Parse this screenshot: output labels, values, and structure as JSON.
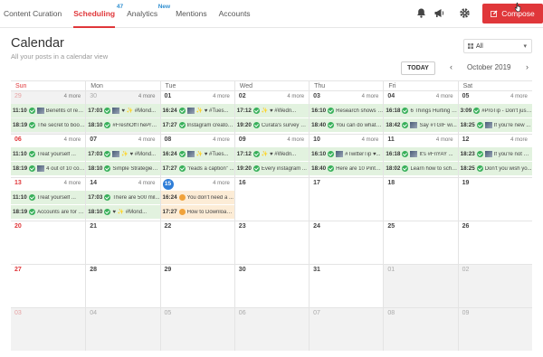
{
  "nav": {
    "items": [
      {
        "label": "Content Curation",
        "badge": "",
        "active": false
      },
      {
        "label": "Scheduling",
        "badge": "47",
        "active": true
      },
      {
        "label": "Analytics",
        "badge": "New",
        "active": false
      },
      {
        "label": "Mentions",
        "badge": "",
        "active": false
      },
      {
        "label": "Accounts",
        "badge": "",
        "active": false
      }
    ],
    "compose_label": "Compose"
  },
  "header": {
    "title": "Calendar",
    "subtitle": "All your posts in a calendar view",
    "filter_value": "All",
    "today_label": "TODAY",
    "month_label": "October 2019"
  },
  "calendar": {
    "day_names": [
      "Sun",
      "Mon",
      "Tue",
      "Wed",
      "Thu",
      "Fri",
      "Sat"
    ],
    "weeks": [
      [
        {
          "day": "29",
          "muted": true,
          "more": "4 more",
          "posts": [
            {
              "time": "11:10",
              "status": "ok",
              "thumb": true,
              "text": "Benefits of red..."
            },
            {
              "time": "18:19",
              "status": "ok",
              "thumb": false,
              "text": "The secret to boos..."
            }
          ]
        },
        {
          "day": "30",
          "muted": true,
          "more": "4 more",
          "posts": [
            {
              "time": "17:03",
              "status": "ok",
              "thumb": true,
              "text": "♥ ✨ #Mond..."
            },
            {
              "time": "18:10",
              "status": "ok",
              "thumb": false,
              "text": "#FreshOffThePres..."
            }
          ]
        },
        {
          "day": "01",
          "muted": false,
          "more": "4 more",
          "posts": [
            {
              "time": "16:24",
              "status": "ok",
              "thumb": true,
              "text": "✨ ♥ #Tues..."
            },
            {
              "time": "17:27",
              "status": "ok",
              "thumb": false,
              "text": "Instagram creator ..."
            }
          ]
        },
        {
          "day": "02",
          "muted": false,
          "more": "4 more",
          "posts": [
            {
              "time": "17:12",
              "status": "ok",
              "thumb": false,
              "text": "✨ ♥ #Wedn..."
            },
            {
              "time": "19:20",
              "status": "ok",
              "thumb": false,
              "text": "Curata's survey sa..."
            }
          ]
        },
        {
          "day": "03",
          "muted": false,
          "more": "4 more",
          "posts": [
            {
              "time": "16:10",
              "status": "ok",
              "thumb": false,
              "text": "Research shows th..."
            },
            {
              "time": "18:40",
              "status": "ok",
              "thumb": false,
              "text": "You can do whate..."
            }
          ]
        },
        {
          "day": "04",
          "muted": false,
          "more": "4 more",
          "posts": [
            {
              "time": "16:18",
              "status": "ok",
              "thumb": false,
              "text": "6 Things Hurting y..."
            },
            {
              "time": "18:42",
              "status": "ok",
              "thumb": true,
              "text": "Say #TGIF wi..."
            }
          ]
        },
        {
          "day": "05",
          "muted": false,
          "more": "4 more",
          "posts": [
            {
              "time": "3:09",
              "status": "ok",
              "thumb": false,
              "text": "#ProTip - Don't just..."
            },
            {
              "time": "18:25",
              "status": "ok",
              "thumb": true,
              "text": "If you're new ..."
            }
          ]
        }
      ],
      [
        {
          "day": "06",
          "muted": false,
          "more": "4 more",
          "posts": [
            {
              "time": "11:10",
              "status": "ok",
              "thumb": false,
              "text": "Treat yourself ..."
            },
            {
              "time": "18:19",
              "status": "ok",
              "thumb": true,
              "text": "4 out of 10 consum..."
            }
          ]
        },
        {
          "day": "07",
          "muted": false,
          "more": "4 more",
          "posts": [
            {
              "time": "17:03",
              "status": "ok",
              "thumb": true,
              "text": "✨ ♥ #Mond..."
            },
            {
              "time": "18:10",
              "status": "ok",
              "thumb": false,
              "text": "Simple Strategies t..."
            }
          ]
        },
        {
          "day": "08",
          "muted": false,
          "more": "4 more",
          "posts": [
            {
              "time": "16:24",
              "status": "ok",
              "thumb": true,
              "text": "✨ ♥ #Tues..."
            },
            {
              "time": "17:27",
              "status": "ok",
              "thumb": false,
              "text": "\"reads a caption\" ..."
            }
          ]
        },
        {
          "day": "09",
          "muted": false,
          "more": "4 more",
          "posts": [
            {
              "time": "17:12",
              "status": "ok",
              "thumb": false,
              "text": "✨ ♥ #Wedn..."
            },
            {
              "time": "19:20",
              "status": "ok",
              "thumb": false,
              "text": "Every instagram ..."
            }
          ]
        },
        {
          "day": "10",
          "muted": false,
          "more": "4 more",
          "posts": [
            {
              "time": "16:10",
              "status": "ok",
              "thumb": true,
              "text": "#TwitterTip ♥..."
            },
            {
              "time": "18:40",
              "status": "ok",
              "thumb": false,
              "text": "Here are 10 Pinter..."
            }
          ]
        },
        {
          "day": "11",
          "muted": false,
          "more": "4 more",
          "posts": [
            {
              "time": "16:18",
              "status": "ok",
              "thumb": true,
              "text": "It's #FriYAY ..."
            },
            {
              "time": "18:02",
              "status": "ok",
              "thumb": false,
              "text": "Learn how to sche..."
            }
          ]
        },
        {
          "day": "12",
          "muted": false,
          "more": "4 more",
          "posts": [
            {
              "time": "18:23",
              "status": "ok",
              "thumb": true,
              "text": "If you're not a ..."
            },
            {
              "time": "18:25",
              "status": "ok",
              "thumb": false,
              "text": "Don't you wish yo..."
            }
          ]
        }
      ],
      [
        {
          "day": "13",
          "muted": false,
          "more": "4 more",
          "posts": [
            {
              "time": "11:10",
              "status": "ok",
              "thumb": false,
              "text": "Treat yourself ..."
            },
            {
              "time": "18:19",
              "status": "ok",
              "thumb": false,
              "text": "Accounts are for s..."
            }
          ]
        },
        {
          "day": "14",
          "muted": false,
          "more": "4 more",
          "posts": [
            {
              "time": "17:03",
              "status": "ok",
              "thumb": false,
              "text": "There are 500 mil..."
            },
            {
              "time": "18:10",
              "status": "ok",
              "thumb": false,
              "text": "♥ ✨ #Mond..."
            }
          ]
        },
        {
          "day": "15",
          "muted": false,
          "today": true,
          "more": "4 more",
          "posts": [
            {
              "time": "16:24",
              "status": "wait",
              "thumb": false,
              "text": "You don't need a ..."
            },
            {
              "time": "17:27",
              "status": "wait",
              "thumb": false,
              "text": "How to Download ..."
            }
          ]
        },
        {
          "day": "16",
          "muted": false,
          "more": "",
          "posts": []
        },
        {
          "day": "17",
          "muted": false,
          "more": "",
          "posts": []
        },
        {
          "day": "18",
          "muted": false,
          "more": "",
          "posts": []
        },
        {
          "day": "19",
          "muted": false,
          "more": "",
          "posts": []
        }
      ],
      [
        {
          "day": "20",
          "muted": false,
          "more": "",
          "posts": []
        },
        {
          "day": "21",
          "muted": false,
          "more": "",
          "posts": []
        },
        {
          "day": "22",
          "muted": false,
          "more": "",
          "posts": []
        },
        {
          "day": "23",
          "muted": false,
          "more": "",
          "posts": []
        },
        {
          "day": "24",
          "muted": false,
          "more": "",
          "posts": []
        },
        {
          "day": "25",
          "muted": false,
          "more": "",
          "posts": []
        },
        {
          "day": "26",
          "muted": false,
          "more": "",
          "posts": []
        }
      ],
      [
        {
          "day": "27",
          "muted": false,
          "more": "",
          "posts": []
        },
        {
          "day": "28",
          "muted": false,
          "more": "",
          "posts": []
        },
        {
          "day": "29",
          "muted": false,
          "more": "",
          "posts": []
        },
        {
          "day": "30",
          "muted": false,
          "more": "",
          "posts": []
        },
        {
          "day": "31",
          "muted": false,
          "more": "",
          "posts": []
        },
        {
          "day": "01",
          "muted": true,
          "more": "",
          "posts": []
        },
        {
          "day": "02",
          "muted": true,
          "more": "",
          "posts": []
        }
      ],
      [
        {
          "day": "03",
          "muted": true,
          "more": "",
          "posts": []
        },
        {
          "day": "04",
          "muted": true,
          "more": "",
          "posts": []
        },
        {
          "day": "05",
          "muted": true,
          "more": "",
          "posts": []
        },
        {
          "day": "06",
          "muted": true,
          "more": "",
          "posts": []
        },
        {
          "day": "07",
          "muted": true,
          "more": "",
          "posts": []
        },
        {
          "day": "08",
          "muted": true,
          "more": "",
          "posts": []
        },
        {
          "day": "09",
          "muted": true,
          "more": "",
          "posts": []
        }
      ]
    ]
  },
  "colors": {
    "accent": "#e0373a",
    "published": "#e2f2df",
    "pending": "#fcecd6",
    "today": "#2f7ed8"
  }
}
